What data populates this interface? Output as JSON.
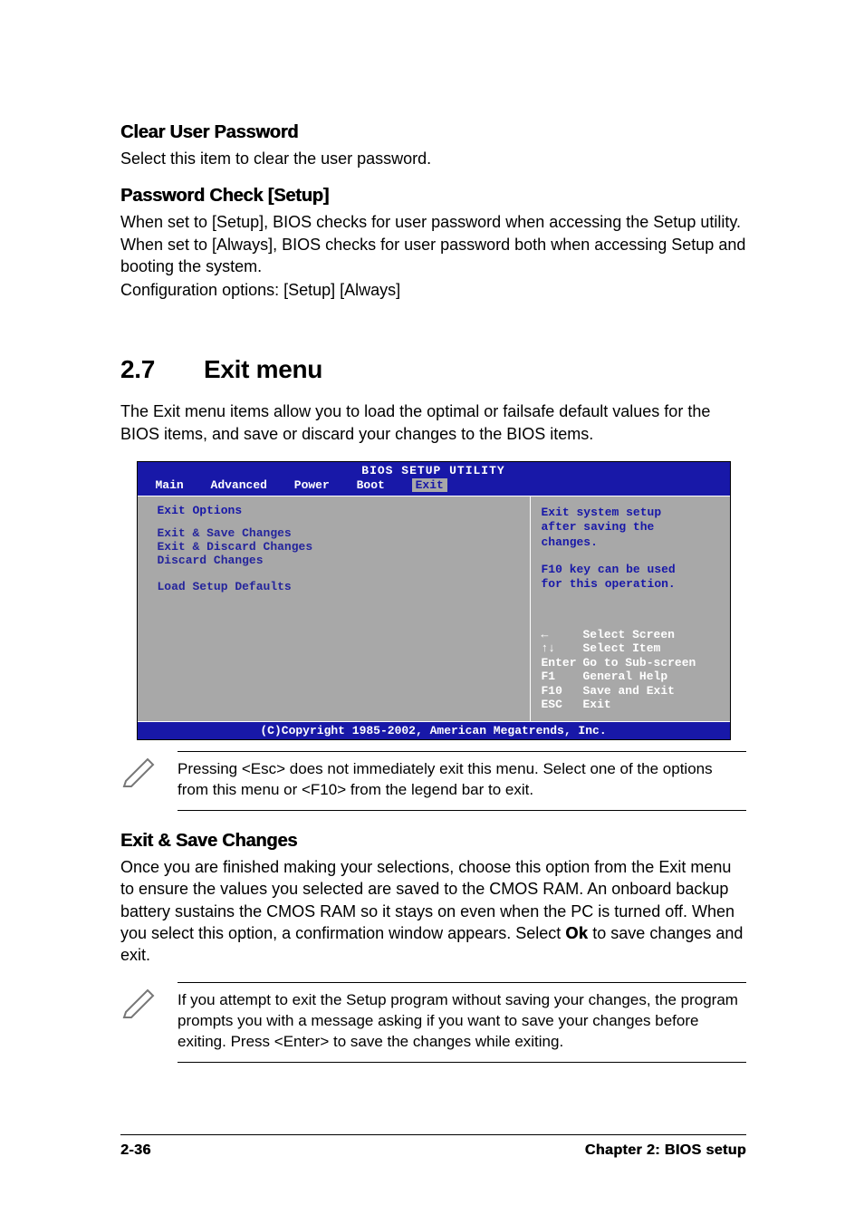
{
  "s1": {
    "title": "Clear User Password",
    "text": "Select this item to clear the user password."
  },
  "s2": {
    "title": "Password Check [Setup]",
    "text": "When set to [Setup], BIOS checks for user password when accessing the Setup utility. When set to [Always], BIOS checks for user password both when accessing Setup and booting the system.",
    "config": "Configuration options: [Setup] [Always]"
  },
  "section": {
    "num": "2.7",
    "title": "Exit menu",
    "intro": "The Exit menu items allow you to load the optimal or failsafe default values for the BIOS items, and save or discard your changes to the BIOS items."
  },
  "bios": {
    "title": "BIOS SETUP UTILITY",
    "tabs": {
      "main": "Main",
      "advanced": "Advanced",
      "power": "Power",
      "boot": "Boot",
      "exit": "Exit"
    },
    "left": {
      "group": "Exit Options",
      "i1": "Exit & Save Changes",
      "i2": "Exit & Discard Changes",
      "i3": "Discard Changes",
      "i4": "Load Setup Defaults"
    },
    "help": {
      "l1": "Exit system setup",
      "l2": "after saving the",
      "l3": "changes.",
      "l4": "F10 key can be used",
      "l5": "for this operation."
    },
    "keys": {
      "r1s": "←",
      "r1t": "Select Screen",
      "r2s": "↑↓",
      "r2t": "Select Item",
      "r3s": "Enter",
      "r3t": "Go to Sub-screen",
      "r4s": "F1",
      "r4t": "General Help",
      "r5s": "F10",
      "r5t": "Save and Exit",
      "r6s": "ESC",
      "r6t": "Exit"
    },
    "footer": "(C)Copyright 1985-2002, American Megatrends, Inc."
  },
  "note1": "Pressing <Esc> does not immediately exit this menu. Select one of the options from this menu or <F10> from the legend bar to exit.",
  "s3": {
    "title": "Exit & Save Changes",
    "p1": "Once you are finished making your selections, choose this option from the Exit menu to ensure the values you selected are saved to the CMOS RAM. An onboard backup battery sustains the CMOS RAM so it stays on even when the PC is turned off. When you select this option, a confirmation window appears. Select ",
    "ok": "Ok",
    "p2": " to save changes and exit."
  },
  "note2": "If you attempt to exit the Setup program without saving your changes, the program prompts you with a message asking if you want to save your changes before exiting. Press <Enter> to save the changes while exiting.",
  "footer": {
    "page": "2-36",
    "chapter": "Chapter 2: BIOS setup"
  }
}
